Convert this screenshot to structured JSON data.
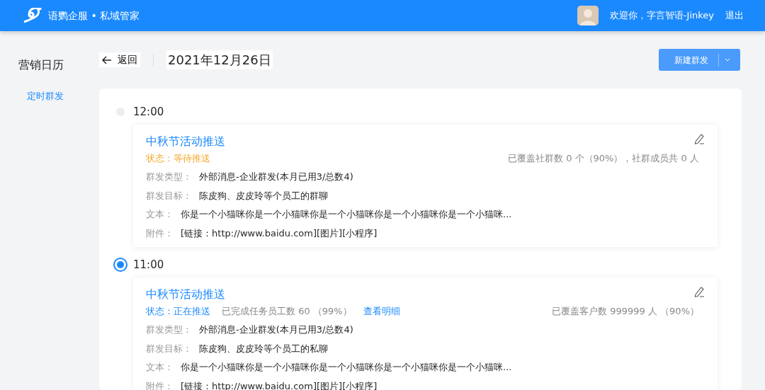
{
  "header": {
    "brand": "语鹦企服 • 私域管家",
    "welcome": "欢迎你，字言智语-Jinkey",
    "logout": "退出"
  },
  "sidebar": {
    "title": "营销日历",
    "items": [
      {
        "label": "定时群发",
        "selected": true
      }
    ]
  },
  "toolbar": {
    "back": "返回",
    "date": "2021年12月26日",
    "new_button": "新建群发"
  },
  "tasks": [
    {
      "time": "12:00",
      "active": false,
      "title": "中秋节活动推送",
      "status": {
        "kind": "waiting",
        "text": "状态：等待推送"
      },
      "coverage": "已覆盖社群数 0 个（90%），社群成员共 0 人",
      "fields": [
        {
          "label": "群发类型：",
          "value": "外部消息-企业群发(本月已用3/总数4)"
        },
        {
          "label": "群发目标：",
          "value": "陈皮狗、皮皮玲等个员工的群聊"
        },
        {
          "label": "文本：",
          "value": "你是一个小猫咪你是一个小猫咪你是一个小猫咪你是一个小猫咪你是一个小猫咪..."
        },
        {
          "label": "附件：",
          "value": "[链接：http://www.baidu.com][图片][小程序]"
        }
      ]
    },
    {
      "time": "11:00",
      "active": true,
      "title": "中秋节活动推送",
      "status": {
        "kind": "sending",
        "text": "状态：正在推送",
        "progress": "已完成任务员工数 60 （99%）",
        "detail_link": "查看明细"
      },
      "coverage": "已覆盖客户数 999999 人 （90%）",
      "fields": [
        {
          "label": "群发类型：",
          "value": "外部消息-企业群发(本月已用3/总数4)"
        },
        {
          "label": "群发目标：",
          "value": "陈皮狗、皮皮玲等个员工的私聊"
        },
        {
          "label": "文本：",
          "value": "你是一个小猫咪你是一个小猫咪你是一个小猫咪你是一个小猫咪你是一个小猫咪..."
        },
        {
          "label": "附件：",
          "value": "[链接：http://www.baidu.com][图片][小程序]"
        }
      ]
    }
  ]
}
